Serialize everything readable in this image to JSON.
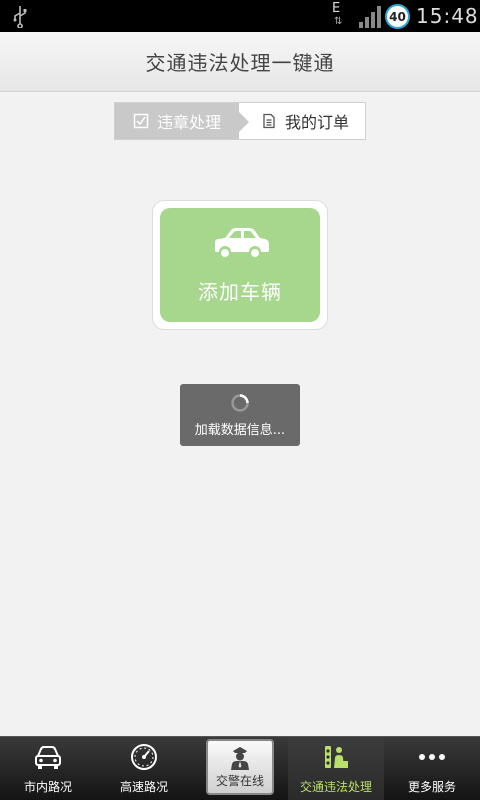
{
  "status_bar": {
    "network_type": "E",
    "battery_level": "40",
    "time": "15:48",
    "icons": [
      "usb-icon",
      "network-arrows-icon",
      "signal-icon",
      "battery-icon"
    ]
  },
  "header": {
    "title": "交通违法处理一键通"
  },
  "tabs": [
    {
      "label": "违章处理",
      "icon": "checkbox-icon",
      "active": true
    },
    {
      "label": "我的订单",
      "icon": "document-icon",
      "active": false
    }
  ],
  "add_vehicle": {
    "label": "添加车辆",
    "icon": "car-icon",
    "color": "#a6d78c"
  },
  "loading": {
    "text": "加载数据信息..."
  },
  "bottom_nav": {
    "items": [
      {
        "label": "市内路况",
        "icon": "car-front-icon"
      },
      {
        "label": "高速路况",
        "icon": "speedometer-icon"
      },
      {
        "label": "交警在线",
        "icon": "police-officer-icon"
      },
      {
        "label": "交通违法处理",
        "icon": "traffic-violation-icon",
        "selected": true
      },
      {
        "label": "更多服务",
        "icon": "more-dots-icon"
      }
    ],
    "selected_color": "#b8e06a"
  }
}
